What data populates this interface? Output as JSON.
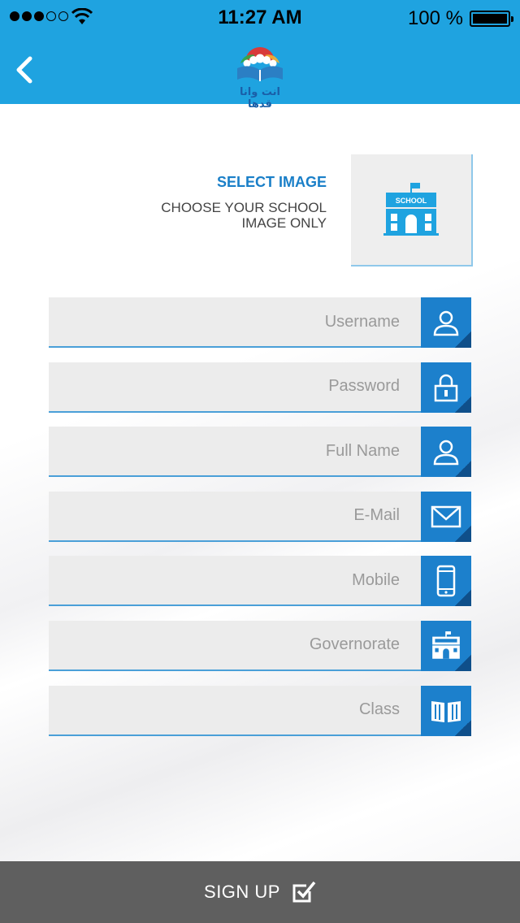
{
  "status_bar": {
    "time": "11:27 AM",
    "battery_text": "100 %",
    "signal_dots_filled": 3,
    "signal_dots_total": 5
  },
  "navbar": {
    "back_icon": "chevron-left-icon",
    "logo_text": "انت وانا قدها",
    "background_color": "#1fa3e0"
  },
  "image_picker": {
    "title": "SELECT IMAGE",
    "hint_line1": "CHOOSE YOUR SCHOOL",
    "hint_line2": "IMAGE ONLY",
    "icon": "school-icon",
    "icon_label": "SCHOOL"
  },
  "form": {
    "fields": [
      {
        "placeholder": "Username",
        "value": "",
        "icon": "user-icon"
      },
      {
        "placeholder": "Password",
        "value": "",
        "icon": "lock-icon"
      },
      {
        "placeholder": "Full Name",
        "value": "",
        "icon": "user-icon"
      },
      {
        "placeholder": "E-Mail",
        "value": "",
        "icon": "envelope-icon"
      },
      {
        "placeholder": "Mobile",
        "value": "",
        "icon": "mobile-phone-icon"
      },
      {
        "placeholder": "Governorate",
        "value": "",
        "icon": "school-icon"
      },
      {
        "placeholder": "Class",
        "value": "",
        "icon": "book-icon"
      }
    ],
    "accent_color": "#1c80cc"
  },
  "signup": {
    "label": "SIGN UP",
    "icon": "checkbox-checked-icon",
    "background_color": "#5f5f5f"
  }
}
